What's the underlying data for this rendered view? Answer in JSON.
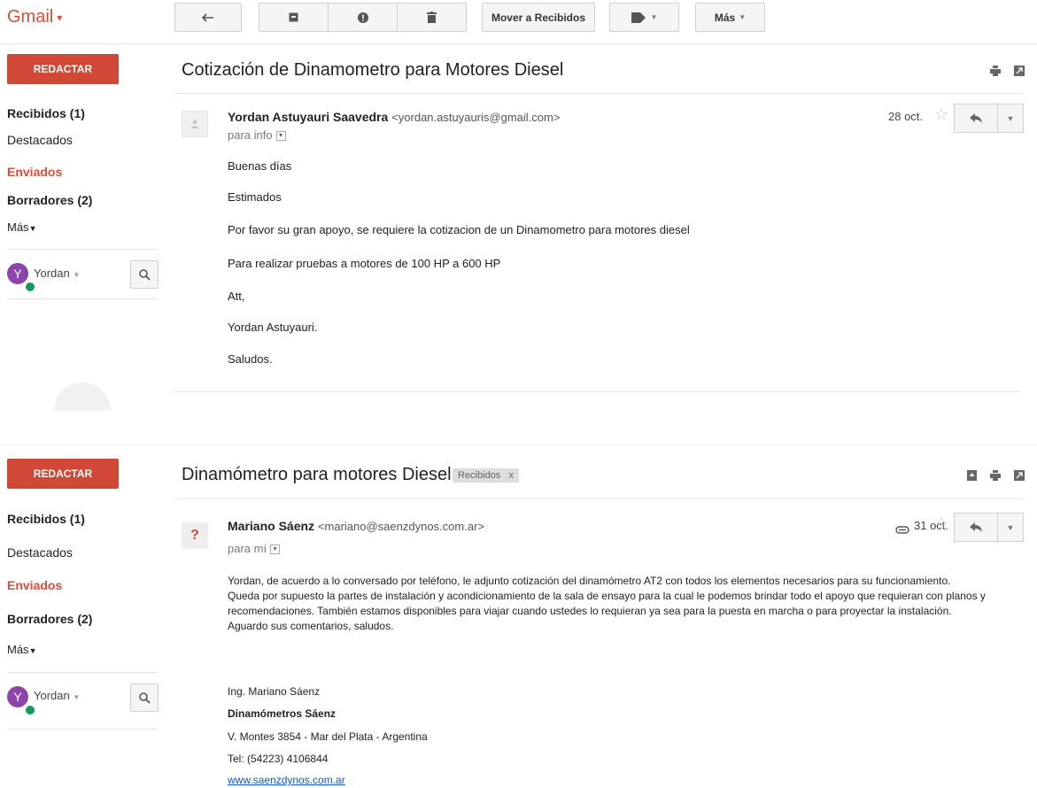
{
  "app": {
    "title": "Gmail"
  },
  "toolbar": {
    "move_to_inbox": "Mover a Recibidos",
    "more": "Más"
  },
  "pane1": {
    "compose": "REDACTAR",
    "nav": {
      "inbox": "Recibidos (1)",
      "starred": "Destacados",
      "sent": "Enviados",
      "drafts": "Borradores (2)",
      "more": "Más"
    },
    "user": {
      "initial": "Y",
      "name": "Yordan"
    },
    "email": {
      "subject": "Cotización de Dinamometro para Motores Diesel",
      "sender_name": "Yordan Astuyauri Saavedra",
      "sender_email": "<yordan.astuyauris@gmail.com>",
      "to": "para info",
      "date": "28 oct.",
      "lines": [
        "Buenas días",
        "Estimados",
        "Por favor su gran apoyo, se requiere la cotizacion de un Dinamometro para motores diesel",
        "Para realizar pruebas a motores de 100 HP a 600 HP",
        "Att,",
        "Yordan Astuyauri.",
        "Saludos."
      ]
    }
  },
  "pane2": {
    "compose": "REDACTAR",
    "nav": {
      "inbox": "Recibidos (1)",
      "starred": "Destacados",
      "sent": "Enviados",
      "drafts": "Borradores (2)",
      "more": "Más"
    },
    "user": {
      "initial": "Y",
      "name": "Yordan"
    },
    "email": {
      "subject": "Dinamómetro para motores Diesel",
      "label": "Recibidos",
      "label_close": "x",
      "sender_name": "Mariano Sáenz",
      "sender_email": "<mariano@saenzdynos.com.ar>",
      "sender_avatar": "?",
      "to": "para mí",
      "date": "31 oct.",
      "body": [
        "Yordan, de acuerdo a lo conversado por teléfono, le adjunto cotización del dinamómetro AT2 con todos los elementos necesarios para su funcionamiento.",
        "Queda por supuesto la partes de instalación y acondicionamiento de la sala de ensayo para la cual le podemos brindar todo el apoyo que requieran con planos y recomendaciones. También estamos disponibles para viajar cuando ustedes lo requieran ya sea para la puesta en marcha o para proyectar la instalación.",
        "Aguardo sus comentarios, saludos."
      ],
      "signature": {
        "name": "Ing. Mariano Sáenz",
        "company": "Dinamómetros Sáenz",
        "address": "V. Montes 3854 - Mar del Plata - Argentina",
        "phone": "Tel: (54223) 4106844",
        "website": "www.saenzdynos.com.ar"
      }
    }
  },
  "colors": {
    "brand": "#dd4b39",
    "compose": "#d14836",
    "link": "#1155cc",
    "avatar": "#8e44ad",
    "online": "#0f9d58"
  }
}
